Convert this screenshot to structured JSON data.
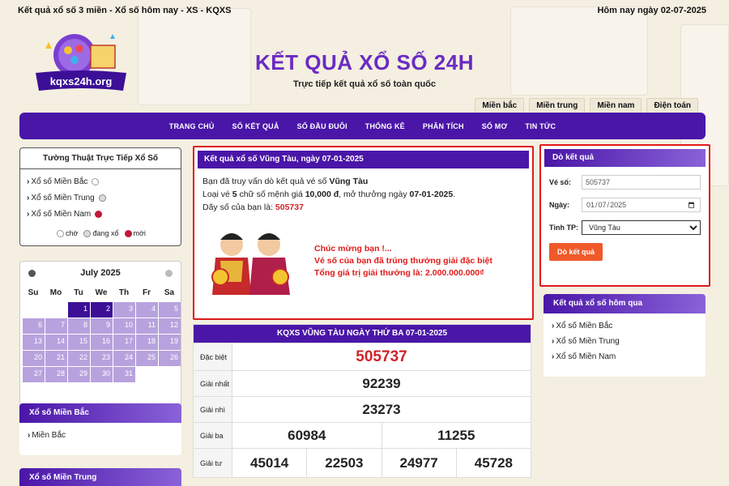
{
  "topbar": {
    "left": "Kết quả xổ số 3 miền - Xổ số hôm nay - XS - KQXS",
    "right": "Hôm nay ngày 02-07-2025"
  },
  "logo": {
    "text": "kqxs24h.org"
  },
  "site": {
    "title": "KẾT QUẢ XỔ SỐ 24H",
    "subtitle": "Trực tiếp kết quả xổ số toàn quốc"
  },
  "region_tabs": [
    "Miền bắc",
    "Miền trung",
    "Miền nam",
    "Điện toán"
  ],
  "nav": [
    "TRANG CHỦ",
    "SỐ KẾT QUẢ",
    "SỐ ĐẦU ĐUÔI",
    "THỐNG KÊ",
    "PHÂN TÍCH",
    "SỐ MƠ",
    "TIN TỨC"
  ],
  "live": {
    "title": "Tường Thuật Trực Tiếp Xổ Số",
    "items": [
      "Xổ số Miền Bắc",
      "Xổ số Miền Trung",
      "Xổ số Miền Nam"
    ],
    "legend": {
      "wait": "chờ",
      "running": "đang xổ",
      "new": "mới"
    }
  },
  "calendar": {
    "month": "July 2025",
    "dow": [
      "Su",
      "Mo",
      "Tu",
      "We",
      "Th",
      "Fr",
      "Sa"
    ],
    "days": [
      [
        "",
        "",
        "1",
        "2",
        "3",
        "4",
        "5"
      ],
      [
        "6",
        "7",
        "8",
        "9",
        "10",
        "11",
        "12"
      ],
      [
        "13",
        "14",
        "15",
        "16",
        "17",
        "18",
        "19"
      ],
      [
        "20",
        "21",
        "22",
        "23",
        "24",
        "25",
        "26"
      ],
      [
        "27",
        "28",
        "29",
        "30",
        "31",
        "",
        ""
      ]
    ]
  },
  "side_boxes": [
    {
      "title": "Xổ số Miền Bắc",
      "item": "Miền Bắc"
    },
    {
      "title": "Xổ số Miền Trung"
    }
  ],
  "result": {
    "header": "Kết quả xổ số Vũng Tàu, ngày 07-01-2025",
    "line1_pre": "Bạn đã truy vấn dò kết quả vé số ",
    "line1_bold": "Vũng Tàu",
    "line2_pre": "Loại vé ",
    "line2_b1": "5",
    "line2_mid": " chữ số mệnh giá ",
    "line2_b2": "10,000 đ",
    "line2_mid2": ", mở thưởng ngày ",
    "line2_b3": "07-01-2025",
    "line2_end": ".",
    "line3_pre": "Dãy số của bạn là: ",
    "line3_num": "505737",
    "congrats": [
      "Chúc mừng bạn !...",
      "Vé số của bạn đã trúng thưởng giải đặc biệt",
      "Tổng giá trị giải thưởng là: 2.000.000.000₫"
    ]
  },
  "kq": {
    "header": "KQXS VŨNG TÀU NGÀY THỨ BA 07-01-2025",
    "rows": [
      {
        "label": "Đặc biệt",
        "values": [
          "505737"
        ]
      },
      {
        "label": "Giải nhất",
        "values": [
          "92239"
        ]
      },
      {
        "label": "Giải nhì",
        "values": [
          "23273"
        ]
      },
      {
        "label": "Giải ba",
        "values": [
          "60984",
          "11255"
        ]
      },
      {
        "label": "Giải tư",
        "values": [
          "45014",
          "22503",
          "24977",
          "45728"
        ]
      }
    ]
  },
  "search": {
    "title": "Dò kết quả",
    "ticket_label": "Vé số:",
    "ticket_value": "505737",
    "date_label": "Ngày:",
    "date_value": "2025-01-07",
    "province_label": "Tỉnh TP:",
    "province_value": "Vũng Tàu",
    "button": "Dò kết quả"
  },
  "yesterday": {
    "title": "Kết quả xổ số hôm qua",
    "items": [
      "Xổ số Miền Bắc",
      "Xổ số Miền Trung",
      "Xổ số Miền Nam"
    ]
  },
  "colors": {
    "primary": "#4a16a8",
    "accent": "#e01a1a",
    "button": "#ef5a2a"
  }
}
